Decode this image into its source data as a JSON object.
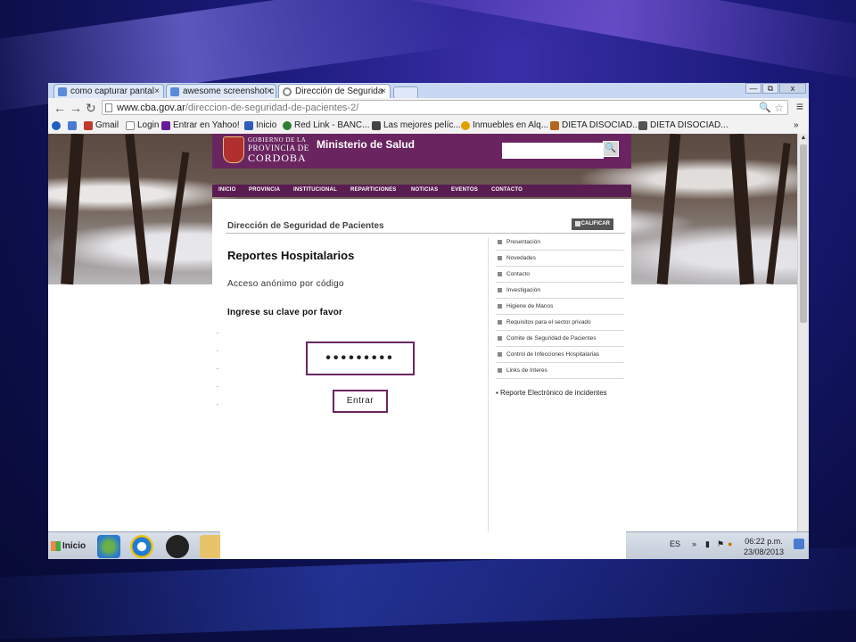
{
  "browser": {
    "tabs": [
      {
        "label": "como capturar pantal",
        "active": false
      },
      {
        "label": "awesome screenshot c",
        "active": false
      },
      {
        "label": "Dirección de Segurida",
        "active": true
      }
    ],
    "window_controls": {
      "minimize": "—",
      "restore": "⧉",
      "close": "x"
    },
    "url_domain": "www.cba.gov.ar",
    "url_path": "/direccion-de-seguridad-de-pacientes-2/",
    "bookmarks": [
      {
        "label": "Gmail",
        "color": "#c0392b"
      },
      {
        "label": "Login",
        "color": "#888888"
      },
      {
        "label": "Entrar en Yahoo!",
        "color": "#6a1b9a"
      },
      {
        "label": "Inicio",
        "color": "#2e5cb8"
      },
      {
        "label": "Red Link - BANC...",
        "color": "#2e7d32"
      },
      {
        "label": "Las mejores pelíc...",
        "color": "#444444"
      },
      {
        "label": "Inmuebles en Alq...",
        "color": "#e0a000"
      },
      {
        "label": "DIETA DISOCIAD...",
        "color": "#b5651d"
      },
      {
        "label": "DIETA DISOCIAD...",
        "color": "#555555"
      }
    ],
    "bookmarks_overflow": "»"
  },
  "site": {
    "gov_line1": "GOBIERNO DE LA",
    "gov_line2": "PROVINCIA DE",
    "gov_line3": "CORDOBA",
    "ministry": "Ministerio de Salud",
    "search_button": "🔍",
    "nav": [
      "INICIO",
      "PROVINCIA",
      "INSTITUCIONAL",
      "REPARTICIONES",
      "NOTICIAS",
      "EVENTOS",
      "CONTACTO"
    ],
    "panel_title": "Dirección de Seguridad de Pacientes",
    "calificar": "CALIFICAR",
    "heading": "Reportes Hospitalarios",
    "anon_text": "Acceso anónimo por código",
    "prompt": "Ingrese su clave por favor",
    "password_mask": "•••••••••",
    "submit_label": "Entrar",
    "sidebar": [
      "Presentación",
      "Novedades",
      "Contacto",
      "Investigación",
      "Higiene de Manos",
      "Requisitos para el sector privado",
      "Comite de Seguridad de Pacientes",
      "Control de Infecciones Hospitalarias",
      "Links de Interes"
    ],
    "sidebar_report": "▪ Reporte Electrónico de incidentes",
    "accent_color": "#6a2560"
  },
  "taskbar": {
    "start_label": "Inicio",
    "language": "ES",
    "time": "06:22 p.m.",
    "date": "23/08/2013"
  }
}
